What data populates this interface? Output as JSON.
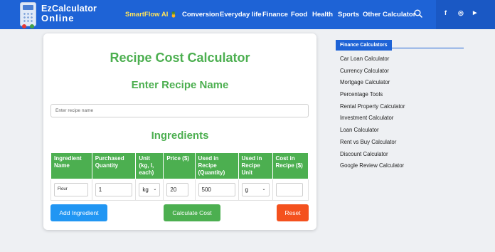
{
  "header": {
    "logo_line1": "EzCalculator",
    "logo_line2": "Online",
    "nav": [
      "SmartFlow AI",
      "Conversion",
      "Everyday life",
      "Finance",
      "Food",
      "Health",
      "Sports",
      "Other Calculator"
    ],
    "smartflow_badge": "🍍",
    "social": [
      "f",
      "◎",
      "▶"
    ]
  },
  "main": {
    "title": "Recipe Cost Calculator",
    "recipe_heading": "Enter Recipe Name",
    "recipe_placeholder": "Enter recipe name",
    "ingredients_heading": "Ingredients",
    "columns": [
      "Ingredient Name",
      "Purchased Quantity",
      "Unit (kg, l, each)",
      "Price ($)",
      "Used in Recipe (Quantity)",
      "Used in Recipe Unit",
      "Cost in Recipe ($)"
    ],
    "row": {
      "name": "Flour",
      "purchased_quantity": "1",
      "unit": "kg",
      "price": "20",
      "used_quantity": "500",
      "used_unit": "g",
      "cost": ""
    },
    "buttons": {
      "add": "Add Ingredient",
      "calculate": "Calculate Cost",
      "reset": "Reset"
    }
  },
  "sidebar": {
    "title": "Finance Calculators",
    "items": [
      "Car Loan Calculator",
      "Currency Calculator",
      "Mortgage Calculator",
      "Percentage Tools",
      "Rental Property Calculator",
      "Investment Calculator",
      "Loan Calculator",
      "Rent vs Buy Calculator",
      "Discount Calculator",
      "Google Review Calculator"
    ]
  },
  "colors": {
    "header_bg": "#1e63d6",
    "heading_green": "#4caf50",
    "add_button": "#2196f3",
    "calculate_button": "#4caf50",
    "reset_button": "#f4511e",
    "nav_highlight": "#ffe45c"
  }
}
